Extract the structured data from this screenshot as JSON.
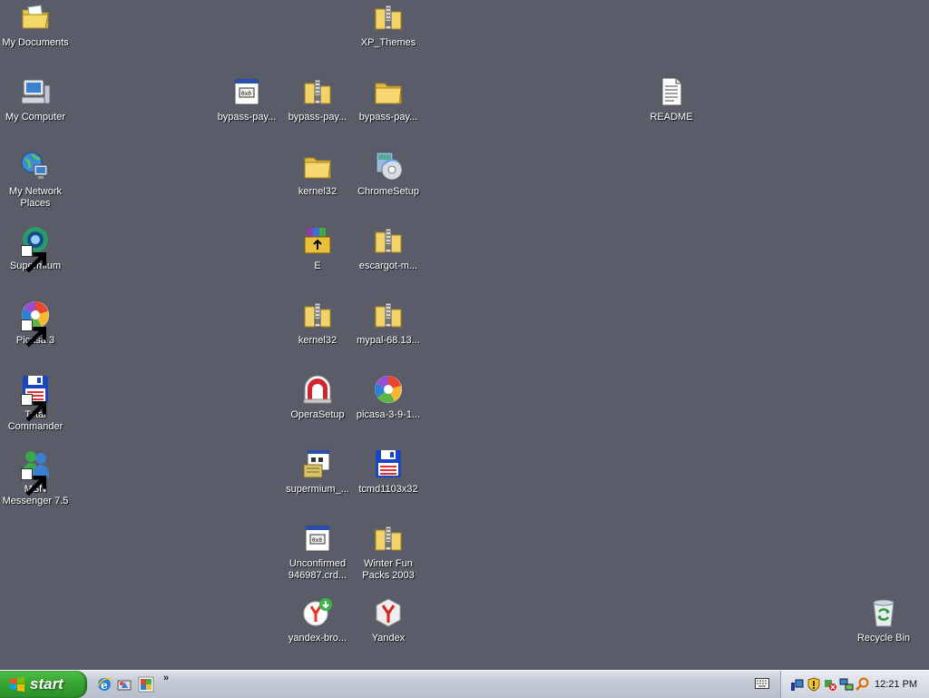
{
  "desktop": {
    "icons": [
      {
        "label": "My Documents",
        "icon": "my-documents-icon"
      },
      {
        "label": "My Computer",
        "icon": "my-computer-icon"
      },
      {
        "label": "My Network Places",
        "icon": "network-places-icon"
      },
      {
        "label": "Supermium",
        "icon": "supermium-icon"
      },
      {
        "label": "Picasa 3",
        "icon": "picasa-icon"
      },
      {
        "label": "Total Commander",
        "icon": "total-commander-icon"
      },
      {
        "label": "MSN Messenger 7.5",
        "icon": "msn-messenger-icon"
      },
      {
        "label": "XP_Themes",
        "icon": "zip-folder-icon"
      },
      {
        "label": "bypass-pay...",
        "icon": "executable-file-icon"
      },
      {
        "label": "bypass-pay...",
        "icon": "zip-folder-icon"
      },
      {
        "label": "bypass-pay...",
        "icon": "folder-icon"
      },
      {
        "label": "README",
        "icon": "text-document-icon"
      },
      {
        "label": "kernel32",
        "icon": "folder-icon"
      },
      {
        "label": "ChromeSetup",
        "icon": "setup-installer-icon"
      },
      {
        "label": "E",
        "icon": "winrar-archive-icon"
      },
      {
        "label": "escargot-m...",
        "icon": "zip-folder-icon"
      },
      {
        "label": "kernel32",
        "icon": "zip-folder-icon"
      },
      {
        "label": "mypal-68.13...",
        "icon": "zip-folder-icon"
      },
      {
        "label": "OperaSetup",
        "icon": "opera-setup-icon"
      },
      {
        "label": "picasa-3-9-1...",
        "icon": "picasa-icon"
      },
      {
        "label": "supermium_...",
        "icon": "installer-program-icon"
      },
      {
        "label": "tcmd1103x32",
        "icon": "total-commander-icon"
      },
      {
        "label": "Unconfirmed 946987.crd...",
        "icon": "executable-file-icon"
      },
      {
        "label": "Winter Fun Packs 2003",
        "icon": "zip-folder-icon"
      },
      {
        "label": "yandex-bro...",
        "icon": "yandex-browser-download-icon"
      },
      {
        "label": "Yandex",
        "icon": "yandex-icon"
      },
      {
        "label": "Recycle Bin",
        "icon": "recycle-bin-icon"
      }
    ]
  },
  "taskbar": {
    "start_label": "start",
    "quick_launch": [
      "internet-explorer-icon",
      "show-desktop-icon",
      "picasa-icon"
    ],
    "chevron": "»",
    "tray_icons": [
      "network-icon",
      "security-shield-icon",
      "safely-remove-icon",
      "network-connection-icon",
      "search-icon"
    ],
    "clock": "12:21 PM"
  },
  "colors": {
    "desktop_background": "#5a5d68",
    "start_button": "#35a632",
    "taskbar": "#c3cad6"
  }
}
